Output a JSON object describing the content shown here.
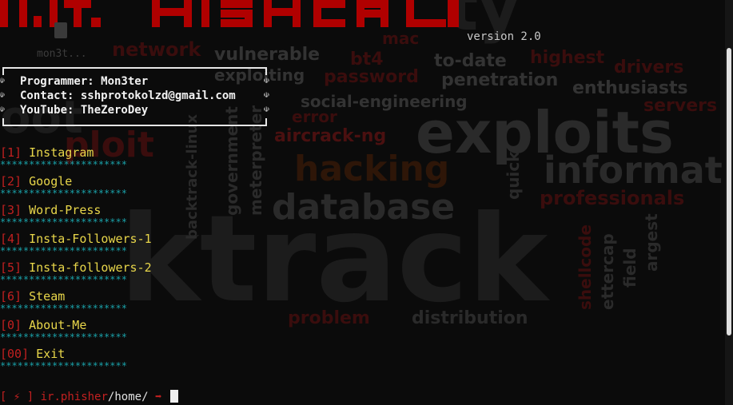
{
  "window": {
    "version": "version 2.0",
    "ghost_file_label": "mon3t..."
  },
  "background_words": [
    "exploits",
    "hacking",
    "database",
    "ktrack",
    "informat",
    "network",
    "vulnerable",
    "bt4",
    "mac",
    "to-date",
    "highest",
    "password",
    "penetration",
    "enthusiasts",
    "social-engineering",
    "drivers",
    "aircrack-ng",
    "professionals",
    "government",
    "meterpreter",
    "backtrack-linux",
    "quick",
    "shellcode",
    "ettercap",
    "field",
    "argest",
    "problem",
    "distribution",
    "exploiting",
    "error",
    "servers"
  ],
  "info": {
    "programmer": "Programmer: Mon3ter",
    "contact": "Contact: sshprotokolzd@gmail.com",
    "youtube": "YouTube: TheZeroDey",
    "marker": "☫"
  },
  "menu": {
    "separator": "**********************",
    "items": [
      {
        "num": "[1]",
        "label": "Instagram"
      },
      {
        "num": "[2]",
        "label": "Google"
      },
      {
        "num": "[3]",
        "label": "Word-Press"
      },
      {
        "num": "[4]",
        "label": "Insta-Followers-1"
      },
      {
        "num": "[5]",
        "label": "Insta-followers-2"
      },
      {
        "num": "[6]",
        "label": "Steam"
      },
      {
        "num": "[0]",
        "label": "About-Me"
      },
      {
        "num": "[00]",
        "label": "Exit"
      }
    ]
  },
  "prompt": {
    "open": "[",
    "symbol": "⚡",
    "close": "]",
    "host": "ir.phisher",
    "path": "/home/",
    "arrow": "➡"
  },
  "colors": {
    "number": "#c22020",
    "label": "#e8d64a",
    "stars": "#1aa0a8",
    "banner": "#b00000"
  }
}
